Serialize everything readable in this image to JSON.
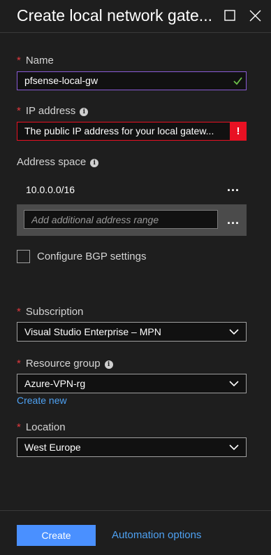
{
  "header": {
    "title": "Create local network gate...",
    "maximize_icon": "maximize-icon",
    "close_icon": "close-icon"
  },
  "form": {
    "name": {
      "label": "Name",
      "value": "pfsense-local-gw",
      "required": true,
      "status_icon": "check-icon"
    },
    "ip_address": {
      "label": "IP address",
      "value": "The public IP address for your local gatew...",
      "required": true,
      "error_badge": "!"
    },
    "address_space": {
      "label": "Address space",
      "entries": [
        "10.0.0.0/16"
      ],
      "more_label": "...",
      "new_placeholder": "Add additional address range"
    },
    "bgp": {
      "label": "Configure BGP settings",
      "checked": false
    },
    "subscription": {
      "label": "Subscription",
      "value": "Visual Studio Enterprise – MPN",
      "required": true
    },
    "resource_group": {
      "label": "Resource group",
      "value": "Azure-VPN-rg",
      "required": true,
      "create_new_label": "Create new"
    },
    "location": {
      "label": "Location",
      "value": "West Europe",
      "required": true
    }
  },
  "footer": {
    "create_label": "Create",
    "automation_label": "Automation options"
  },
  "colors": {
    "background": "#1e1e1e",
    "required_star": "#e0393e",
    "error": "#e81123",
    "valid_border": "#8a5bd6",
    "valid_check": "#6cc24a",
    "link": "#4ea1f2",
    "primary_button": "#4a90ff"
  }
}
